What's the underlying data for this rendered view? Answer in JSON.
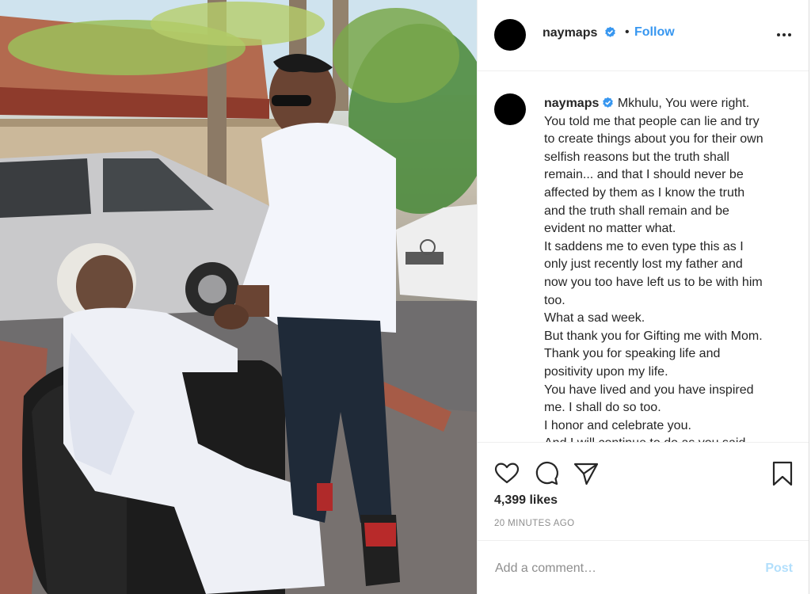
{
  "post": {
    "username": "naymaps",
    "follow_label": "Follow",
    "separator": "•",
    "caption_lines": [
      "Mkhulu, You were right.",
      "You told me that people can lie and try",
      "to create things about you for their own",
      "selfish reasons but the truth shall",
      "remain... and that I should never be",
      "affected by them as I know the truth",
      "and the truth shall remain and be",
      "evident no matter what.",
      "It saddens me to even type this as I",
      "only just recently lost my father and",
      "now you too have left us to be with him",
      "too.",
      "What a sad week.",
      "But thank you for Gifting me with Mom.",
      "Thank you for speaking life and",
      "positivity upon my life.",
      "You have lived and you have inspired",
      "me. I shall do so too.",
      "I honor and celebrate you.",
      "And I will continue to do as you said"
    ],
    "likes": "4,399 likes",
    "timestamp": "20 MINUTES AGO"
  },
  "comment_box": {
    "placeholder": "Add a comment…",
    "post_label": "Post"
  },
  "icons": {
    "verified": "verified-badge-icon",
    "more": "more-options-icon",
    "like": "heart-icon",
    "comment": "comment-bubble-icon",
    "share": "paper-plane-icon",
    "save": "bookmark-icon"
  },
  "colors": {
    "accent": "#3897f0",
    "post_disabled": "#b2dffc",
    "muted": "#8e8e8e",
    "text": "#262626"
  }
}
